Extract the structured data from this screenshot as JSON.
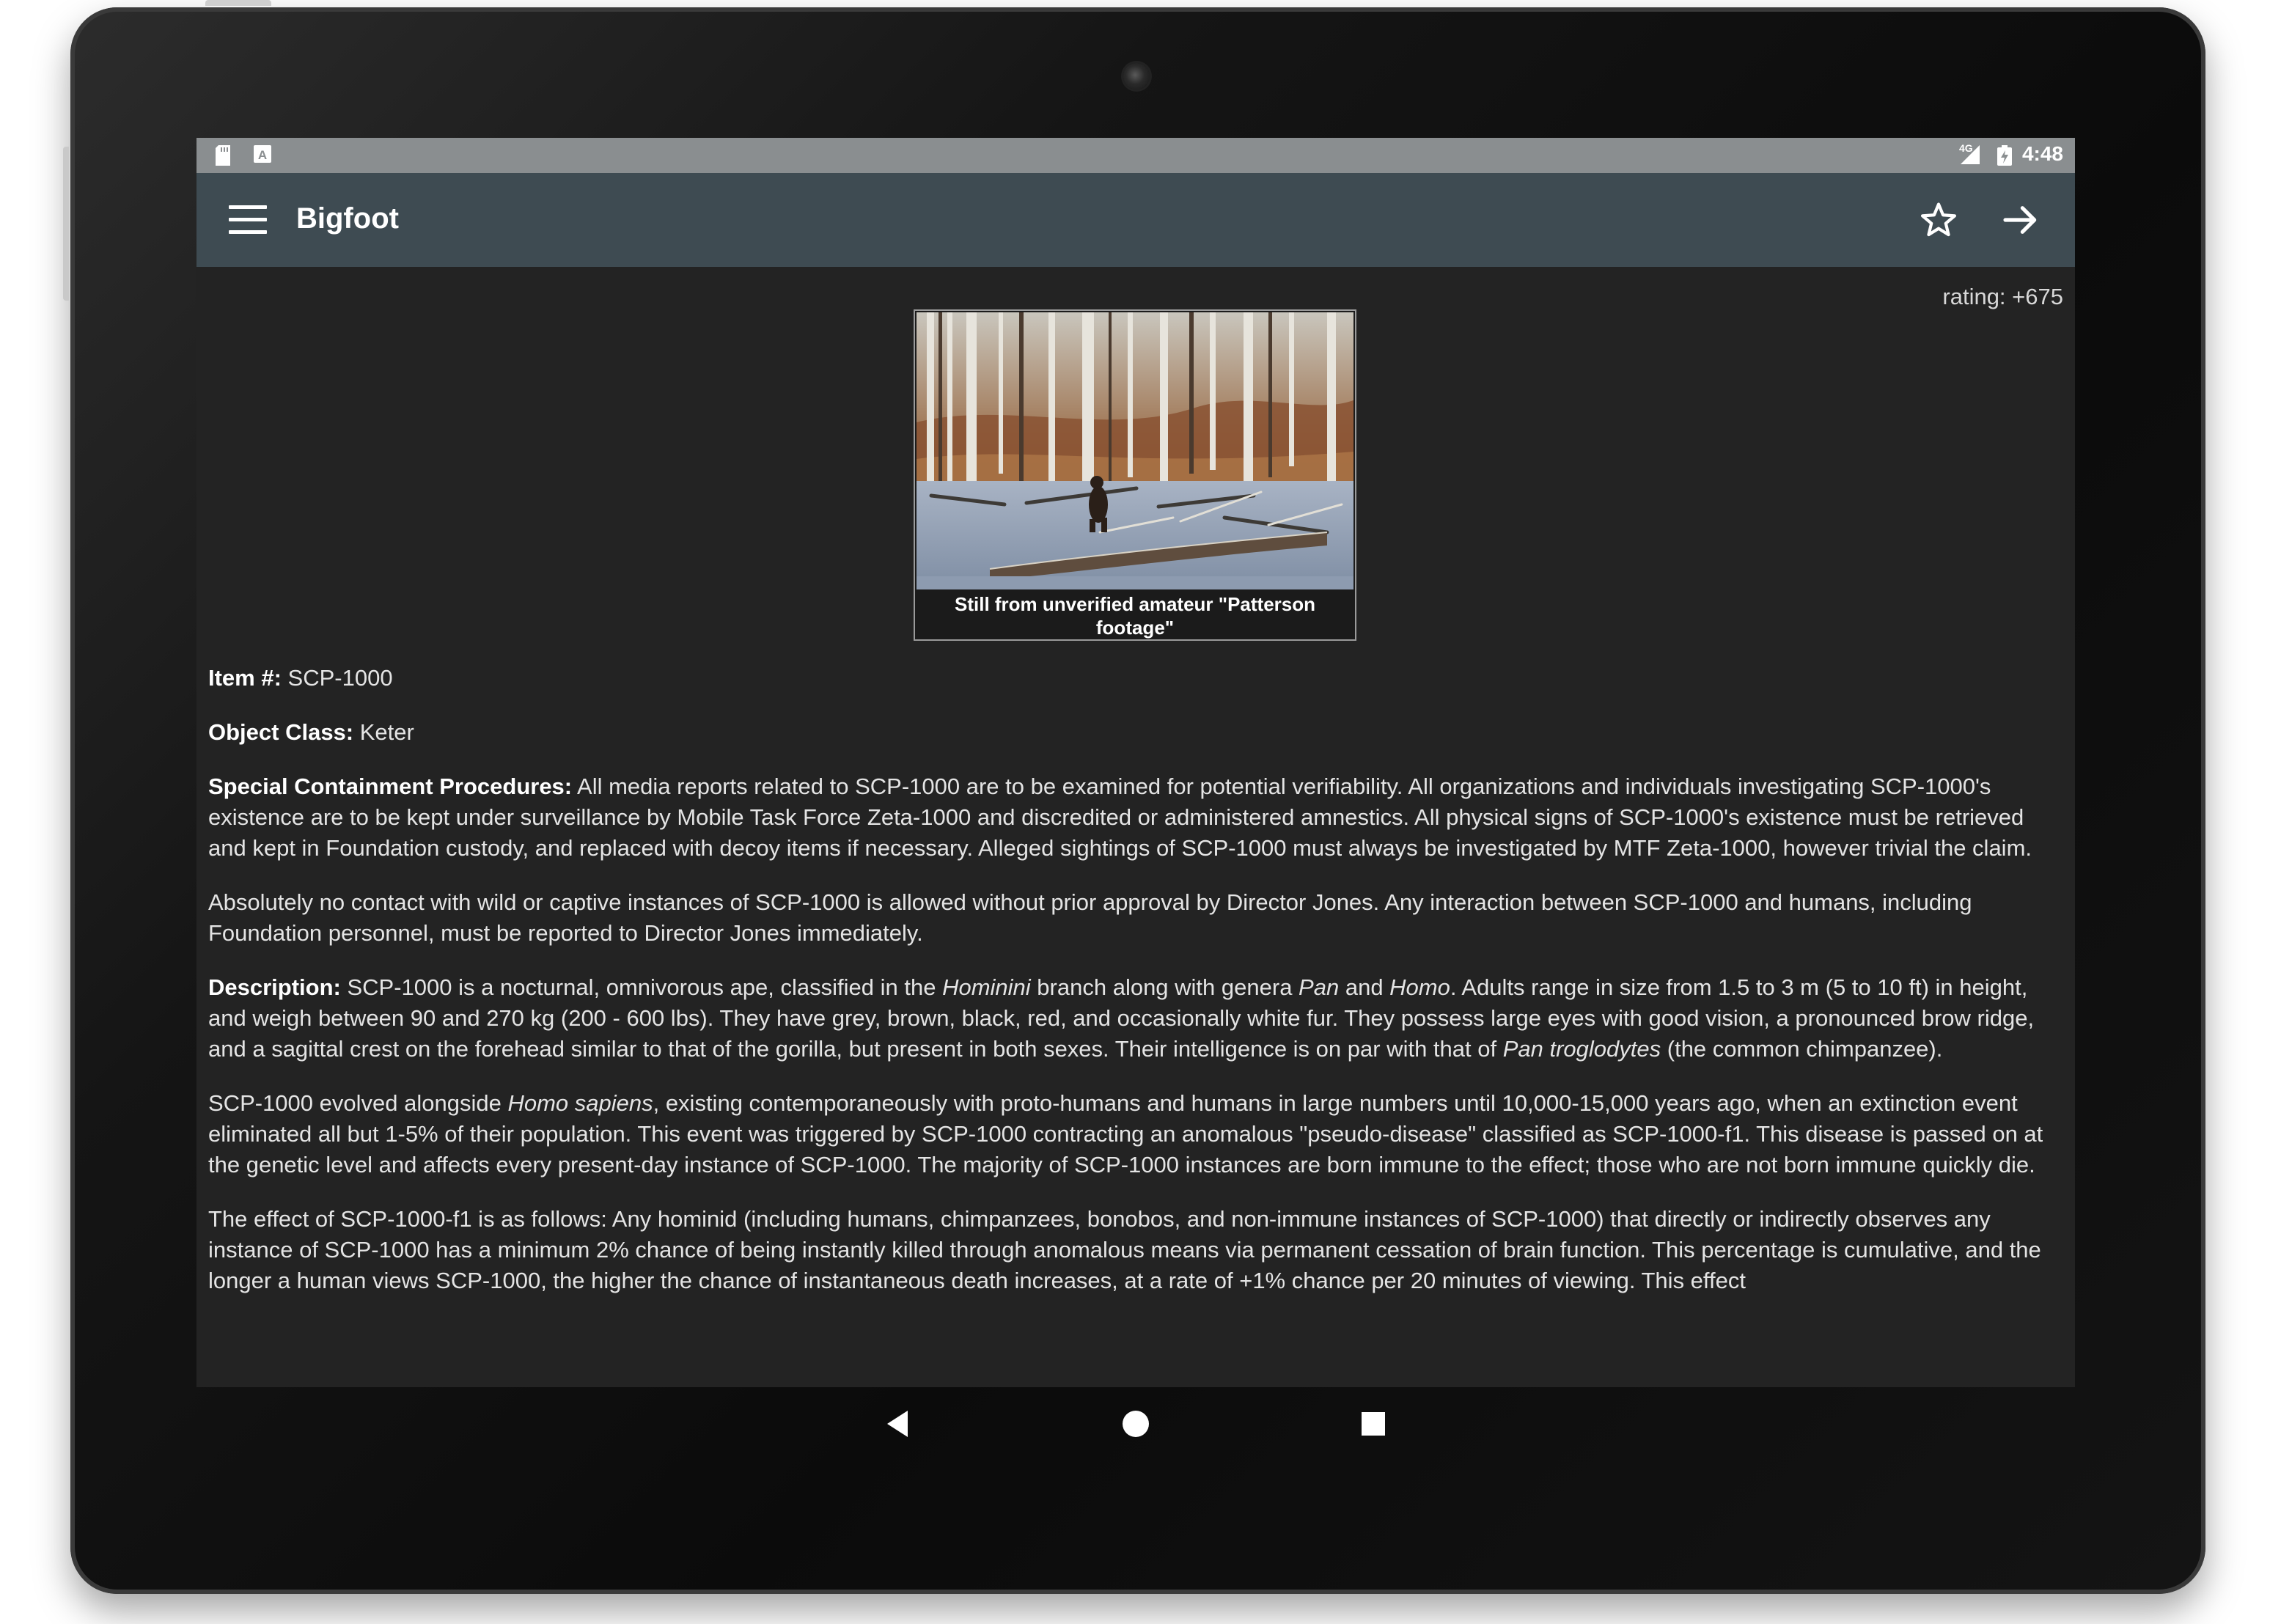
{
  "status_bar": {
    "network": "4G",
    "time": "4:48"
  },
  "app_bar": {
    "title": "Bigfoot",
    "menu_icon": "hamburger-menu-icon",
    "favorite_icon": "star-outline-icon",
    "next_icon": "arrow-forward-icon"
  },
  "article": {
    "rating": "rating: +675",
    "figure": {
      "caption": "Still from unverified amateur \"Patterson footage\""
    },
    "item_label": "Item #:",
    "item_value": " SCP-1000",
    "class_label": "Object Class:",
    "class_value": " Keter",
    "procedures_label": "Special Containment Procedures:",
    "procedures_text": " All media reports related to SCP-1000 are to be examined for potential verifiability. All organizations and individuals investigating SCP-1000's existence are to be kept under surveillance by Mobile Task Force Zeta-1000 and discredited or administered amnestics. All physical signs of SCP-1000's existence must be retrieved and kept in Foundation custody, and replaced with decoy items if necessary. Alleged sightings of SCP-1000 must always be investigated by MTF Zeta-1000, however trivial the claim.",
    "contact_paragraph": "Absolutely no contact with wild or captive instances of SCP-1000 is allowed without prior approval by Director Jones. Any interaction between SCP-1000 and humans, including Foundation personnel, must be reported to Director Jones immediately.",
    "description_label": "Description:",
    "description_1": " SCP-1000 is a nocturnal, omnivorous ape, classified in the ",
    "description_hominini": "Hominini",
    "description_2": " branch along with genera ",
    "description_pan": "Pan",
    "description_3": " and ",
    "description_homo": "Homo",
    "description_4": ". Adults range in size from 1.5 to 3 m (5 to 10 ft) in height, and weigh between 90 and 270 kg (200 - 600 lbs). They have grey, brown, black, red, and occasionally white fur. They possess large eyes with good vision, a pronounced brow ridge, and a sagittal crest on the forehead similar to that of the gorilla, but present in both sexes. Their intelligence is on par with that of ",
    "description_pan_troglodytes": "Pan troglodytes",
    "description_5": " (the common chimpanzee).",
    "evolution_1": "SCP-1000 evolved alongside ",
    "evolution_homo_sapiens": "Homo sapiens",
    "evolution_2": ", existing contemporaneously with proto-humans and humans in large numbers until 10,000-15,000 years ago, when an extinction event eliminated all but 1-5% of their population. This event was triggered by SCP-1000 contracting an anomalous \"pseudo-disease\" classified as SCP-1000-f1. This disease is passed on at the genetic level and affects every present-day instance of SCP-1000. The majority of SCP-1000 instances are born immune to the effect; those who are not born immune quickly die.",
    "effect_paragraph": "The effect of SCP-1000-f1 is as follows: Any hominid (including humans, chimpanzees, bonobos, and non-immune instances of SCP-1000) that directly or indirectly observes any instance of SCP-1000 has a minimum 2% chance of being instantly killed through anomalous means via permanent cessation of brain function. This percentage is cumulative, and the longer a human views SCP-1000, the higher the chance of instantaneous death increases, at a rate of +1% chance per 20 minutes of viewing. This effect"
  },
  "nav_bar": {
    "back_icon": "back-triangle-icon",
    "home_icon": "home-circle-icon",
    "recents_icon": "recents-square-icon"
  }
}
